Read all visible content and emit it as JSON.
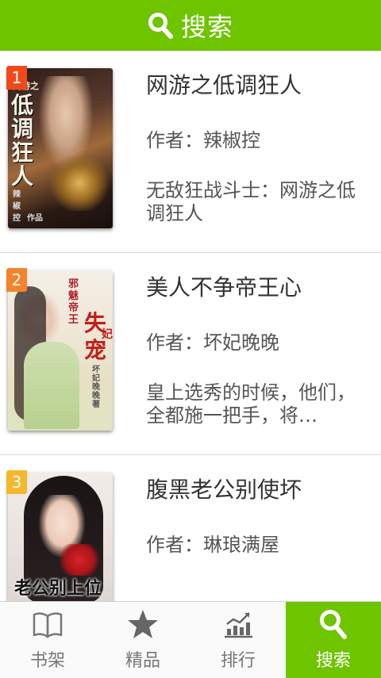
{
  "header": {
    "title": "搜索",
    "accent": "#6fc400"
  },
  "books": [
    {
      "rank": "1",
      "rank_color": "#f2491c",
      "title": "网游之低调狂人",
      "author": "作者：辣椒控",
      "desc": "无敌狂战斗士：网游之低调狂人",
      "cover_text_main": "低调狂人",
      "cover_text_top": "网游之",
      "cover_text_side": "辣椒控",
      "cover_text_foot": "作品"
    },
    {
      "rank": "2",
      "rank_color": "#f5822c",
      "title": "美人不争帝王心",
      "author": "作者：坏妃晚晚",
      "desc": "皇上选秀的时候，他们，全都施一把手，将…",
      "cover_text_main": "失宠",
      "cover_text_top": "邪魅帝王",
      "cover_text_side": "妃",
      "cover_text_foot": "坏妃晚晚著"
    },
    {
      "rank": "3",
      "rank_color": "#f5b82c",
      "title": "腹黑老公别使坏",
      "author": "作者：琳琅满屋",
      "desc": "",
      "cover_text_main": "老公别上位",
      "cover_text_top": "",
      "cover_text_side": "",
      "cover_text_foot": ""
    }
  ],
  "tabs": [
    {
      "label": "书架",
      "icon": "book-icon"
    },
    {
      "label": "精品",
      "icon": "star-icon"
    },
    {
      "label": "排行",
      "icon": "chart-icon"
    },
    {
      "label": "搜索",
      "icon": "search-icon"
    }
  ]
}
